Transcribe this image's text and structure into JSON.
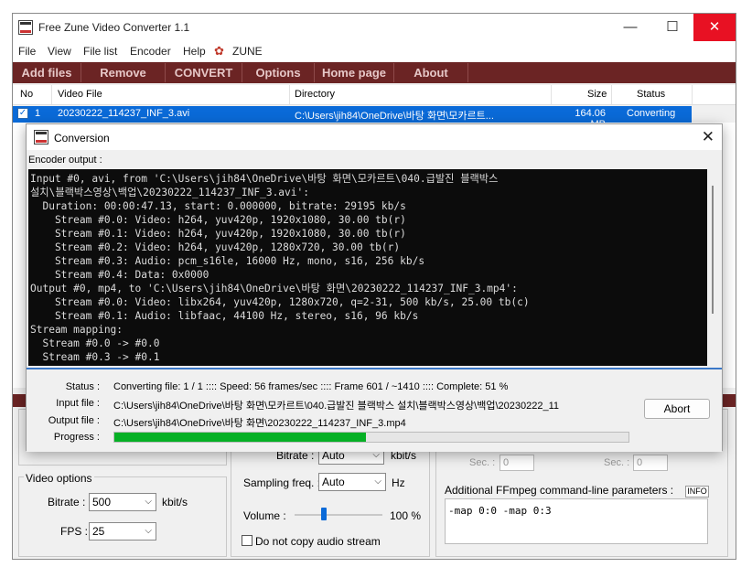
{
  "window": {
    "title": "Free Zune Video Converter 1.1",
    "controls": {
      "minimize": "—",
      "maximize": "☐",
      "close": "✕"
    }
  },
  "menu": [
    "File",
    "View",
    "File list",
    "Encoder",
    "Help",
    "ZUNE"
  ],
  "toolbar": [
    "Add files",
    "Remove",
    "CONVERT",
    "Options",
    "Home page",
    "About"
  ],
  "list": {
    "headers": [
      "No",
      "Video File",
      "Directory",
      "Size",
      "Status"
    ],
    "rows": [
      {
        "no": "1",
        "file": "20230222_114237_INF_3.avi",
        "directory": "C:\\Users\\jih84\\OneDrive\\바탕 화면\\모카르트...",
        "size": "164.06 MB",
        "status": "Converting"
      }
    ]
  },
  "options": {
    "bitrate_top": "Bitrate :",
    "bitrate_top_value": "Auto",
    "bitrate_top_unit": "kbit/s",
    "sec_label": "Sec. :",
    "sec_value": "0",
    "video_options_title": "Video options",
    "video_bitrate_label": "Bitrate :",
    "video_bitrate_value": "500",
    "video_bitrate_unit": "kbit/s",
    "fps_label": "FPS :",
    "fps_value": "25",
    "sampling_label": "Sampling freq. :",
    "sampling_value": "Auto",
    "sampling_unit": "Hz",
    "volume_label": "Volume :",
    "volume_value": "100 %",
    "volume_fraction": 0.33,
    "no_copy_audio": "Do not copy audio stream",
    "ffmpeg_label": "Additional FFmpeg command-line parameters :",
    "info_button": "INFO",
    "ffmpeg_value": "-map 0:0 -map 0:3"
  },
  "dialog": {
    "title": "Conversion",
    "close": "✕",
    "encoder_output_label": "Encoder output :",
    "console_lines": [
      "Input #0, avi, from 'C:\\Users\\jih84\\OneDrive\\바탕 화면\\모카르트\\040.급발진 블랙박스",
      "설치\\블랙박스영상\\백업\\20230222_114237_INF_3.avi':",
      "  Duration: 00:00:47.13, start: 0.000000, bitrate: 29195 kb/s",
      "    Stream #0.0: Video: h264, yuv420p, 1920x1080, 30.00 tb(r)",
      "    Stream #0.1: Video: h264, yuv420p, 1920x1080, 30.00 tb(r)",
      "    Stream #0.2: Video: h264, yuv420p, 1280x720, 30.00 tb(r)",
      "    Stream #0.3: Audio: pcm_s16le, 16000 Hz, mono, s16, 256 kb/s",
      "    Stream #0.4: Data: 0x0000",
      "Output #0, mp4, to 'C:\\Users\\jih84\\OneDrive\\바탕 화면\\20230222_114237_INF_3.mp4':",
      "    Stream #0.0: Video: libx264, yuv420p, 1280x720, q=2-31, 500 kb/s, 25.00 tb(c)",
      "    Stream #0.1: Audio: libfaac, 44100 Hz, stereo, s16, 96 kb/s",
      "Stream mapping:",
      "  Stream #0.0 -> #0.0",
      "  Stream #0.3 -> #0.1"
    ],
    "status_label": "Status :",
    "status_value": "Converting file: 1 / 1  ::::  Speed: 56 frames/sec  ::::  Frame 601 / ~1410  ::::  Complete: 51 %",
    "input_label": "Input file :",
    "input_value": "C:\\Users\\jih84\\OneDrive\\바탕 화면\\모카르트\\040.급발진 블랙박스 설치\\블랙박스영상\\백업\\20230222_11",
    "output_label": "Output file :",
    "output_value": "C:\\Users\\jih84\\OneDrive\\바탕 화면\\20230222_114237_INF_3.mp4",
    "progress_label": "Progress :",
    "progress_fraction": 0.49,
    "abort_label": "Abort"
  },
  "colors": {
    "toolbar_bg": "#6b2424",
    "selection": "#0a6ad8",
    "progress": "#06b025",
    "close_hover": "#e81123"
  }
}
